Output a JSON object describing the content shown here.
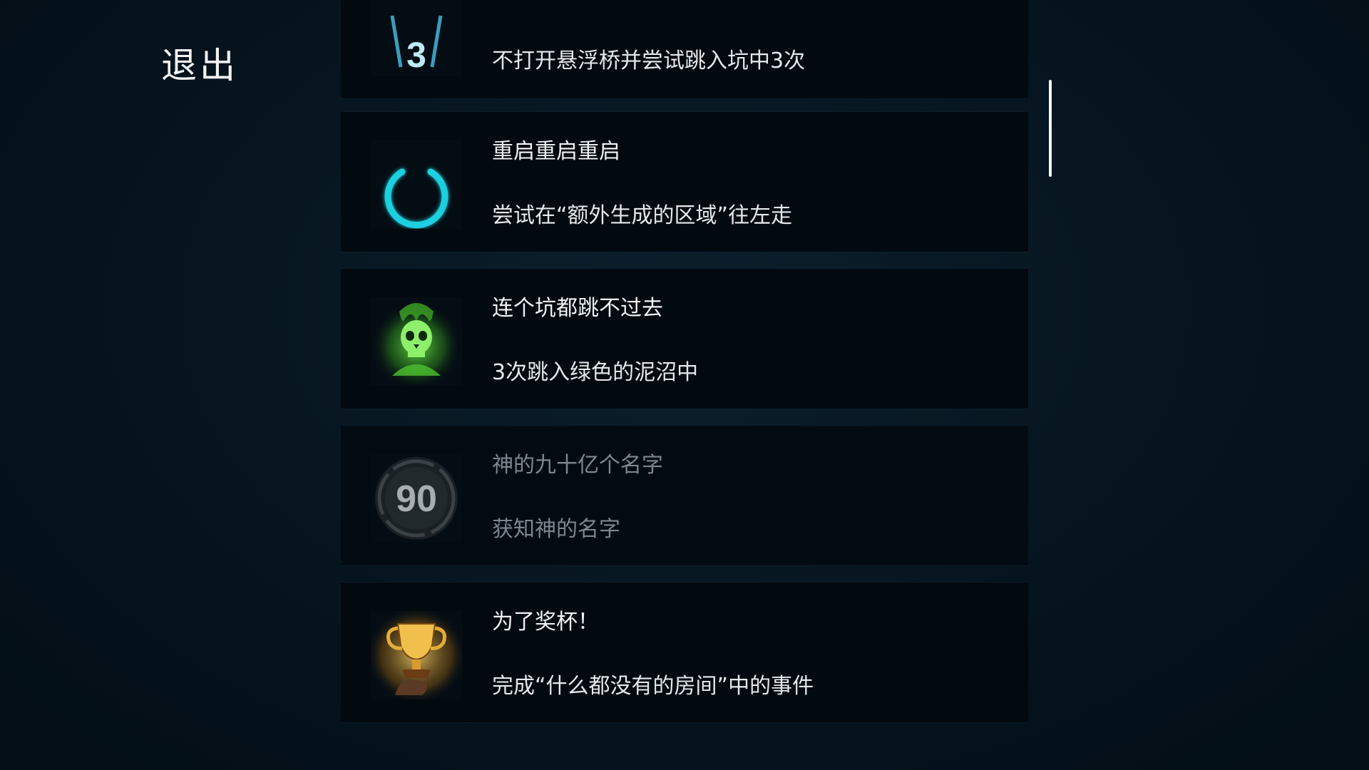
{
  "exit_label": "退出",
  "achievements": [
    {
      "title": "",
      "description": "不打开悬浮桥并尝试跳入坑中3次",
      "icon": "counter-3-icon",
      "icon_text": "3",
      "locked": false
    },
    {
      "title": "重启重启重启",
      "description": "尝试在“额外生成的区域”往左走",
      "icon": "power-icon",
      "locked": false
    },
    {
      "title": "连个坑都跳不过去",
      "description": "3次跳入绿色的泥沼中",
      "icon": "green-skull-icon",
      "locked": false
    },
    {
      "title": "神的九十亿个名字",
      "description": "获知神的名字",
      "icon": "ninety-badge-icon",
      "icon_text": "90",
      "locked": true
    },
    {
      "title": "为了奖杯！",
      "description": "完成“什么都没有的房间”中的事件",
      "icon": "trophy-icon",
      "locked": false
    }
  ],
  "colors": {
    "background": "#06141e",
    "card": "#02090f",
    "power_cyan": "#1fd0e0",
    "skull_green": "#5fd23a",
    "trophy_gold": "#e8b040",
    "locked_text": "#7c8790"
  }
}
